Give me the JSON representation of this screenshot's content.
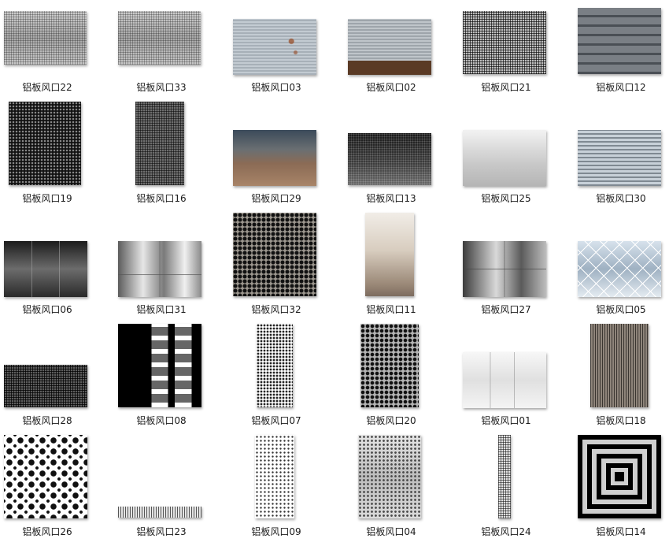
{
  "items": [
    {
      "label": "铝板风口22",
      "pattern": "fine-mesh"
    },
    {
      "label": "铝板风口33",
      "pattern": "fine-mesh"
    },
    {
      "label": "铝板风口03",
      "pattern": "corrugated-rust"
    },
    {
      "label": "铝板风口02",
      "pattern": "corrugated-rust-bottom"
    },
    {
      "label": "铝板风口21",
      "pattern": "grid-mesh"
    },
    {
      "label": "铝板风口12",
      "pattern": "louver-dark"
    },
    {
      "label": "铝板风口19",
      "pattern": "dark-dots"
    },
    {
      "label": "铝板风口16",
      "pattern": "dark-mesh"
    },
    {
      "label": "铝板风口29",
      "pattern": "bronze-panels"
    },
    {
      "label": "铝板风口13",
      "pattern": "dark-gradient-mesh"
    },
    {
      "label": "铝板风口25",
      "pattern": "brushed-light"
    },
    {
      "label": "铝板风口30",
      "pattern": "horizontal-louver"
    },
    {
      "label": "铝板风口06",
      "pattern": "dark-panels"
    },
    {
      "label": "铝板风口31",
      "pattern": "chrome-panels"
    },
    {
      "label": "铝板风口32",
      "pattern": "perforated-large"
    },
    {
      "label": "铝板风口11",
      "pattern": "beige-gradient"
    },
    {
      "label": "铝板风口27",
      "pattern": "chrome-panels"
    },
    {
      "label": "铝板风口05",
      "pattern": "diamond-tiles"
    },
    {
      "label": "铝板风口28",
      "pattern": "grid-mesh"
    },
    {
      "label": "铝板风口08",
      "pattern": "black-slats"
    },
    {
      "label": "铝板风口07",
      "pattern": "white-perforated"
    },
    {
      "label": "铝板风口20",
      "pattern": "perforated-diagonal"
    },
    {
      "label": "铝板风口01",
      "pattern": "white-panels"
    },
    {
      "label": "铝板风口18",
      "pattern": "brown-mesh"
    },
    {
      "label": "铝板风口26",
      "pattern": "polka-random"
    },
    {
      "label": "铝板风口23",
      "pattern": "strip-mesh"
    },
    {
      "label": "铝板风口09",
      "pattern": "white-perforated-sparse"
    },
    {
      "label": "铝板风口04",
      "pattern": "gray-perforated"
    },
    {
      "label": "铝板风口24",
      "pattern": "tall-strip-mesh"
    },
    {
      "label": "铝板风口14",
      "pattern": "concentric-squares"
    }
  ]
}
